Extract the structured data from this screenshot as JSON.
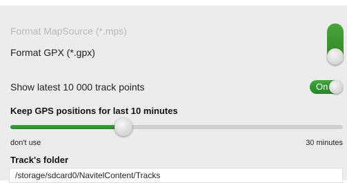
{
  "formats": {
    "mapsource_label": "Format MapSource (*.mps)",
    "gpx_label": "Format GPX (*.gpx)",
    "selected": "gpx"
  },
  "track_points": {
    "label": "Show latest 10 000 track points",
    "toggle_state": "On",
    "enabled": true
  },
  "gps_retention": {
    "label": "Keep GPS positions for last 10 minutes",
    "min_label": "don't use",
    "max_label": "30 minutes",
    "value_fraction": 0.34
  },
  "tracks_folder": {
    "label": "Track's folder",
    "path": "/storage/sdcard0/NavitelContent/Tracks"
  },
  "colors": {
    "accent_green": "#2f9a2f",
    "disabled_text": "#b9b9b9",
    "panel_background": "#ececec"
  }
}
